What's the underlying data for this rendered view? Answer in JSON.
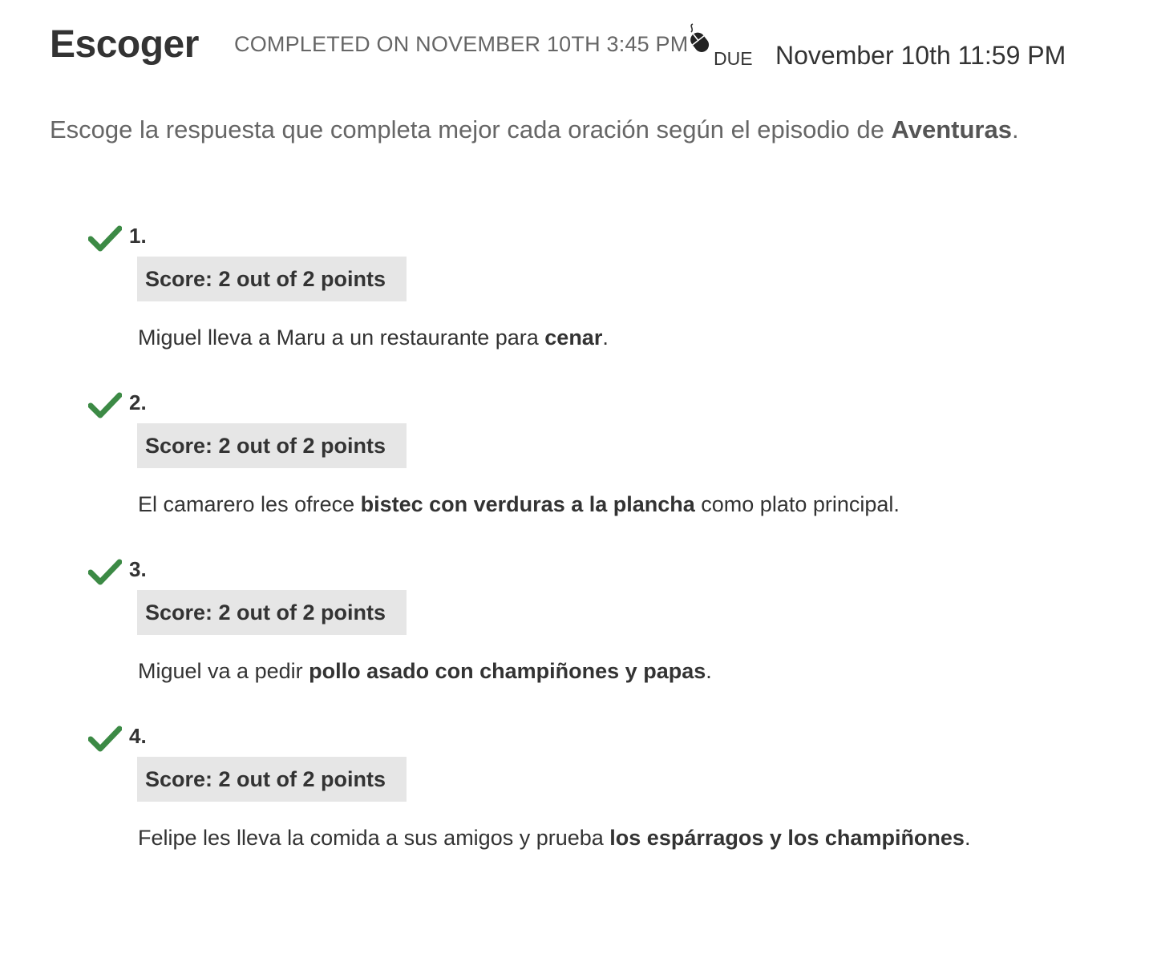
{
  "header": {
    "title": "Escoger",
    "completed_text": "COMPLETED ON NOVEMBER 10TH 3:45 PM",
    "due_label": "DUE",
    "due_date": "November 10th 11:59 PM"
  },
  "instructions": {
    "prefix": "Escoge la respuesta que completa mejor cada oración según el episodio de ",
    "bold": "Aventuras",
    "suffix": "."
  },
  "questions": [
    {
      "number": "1.",
      "score": "Score: 2 out of 2 points",
      "before": "Miguel lleva a Maru a un restaurante para ",
      "answer": "cenar",
      "after": "."
    },
    {
      "number": "2.",
      "score": "Score: 2 out of 2 points",
      "before": "El camarero les ofrece ",
      "answer": "bistec con verduras a la plancha",
      "after": " como plato principal."
    },
    {
      "number": "3.",
      "score": "Score: 2 out of 2 points",
      "before": "Miguel va a pedir ",
      "answer": "pollo asado con champiñones y papas",
      "after": "."
    },
    {
      "number": "4.",
      "score": "Score: 2 out of 2 points",
      "before": "Felipe les lleva la comida a sus amigos y prueba ",
      "answer": "los espárragos y los champiñones",
      "after": "."
    }
  ],
  "icons": {
    "check": "check-icon",
    "mouse": "mouse-icon"
  },
  "colors": {
    "check": "#3c8a45",
    "score_bg": "#e6e6e6",
    "muted_text": "#666666",
    "text": "#333333"
  }
}
